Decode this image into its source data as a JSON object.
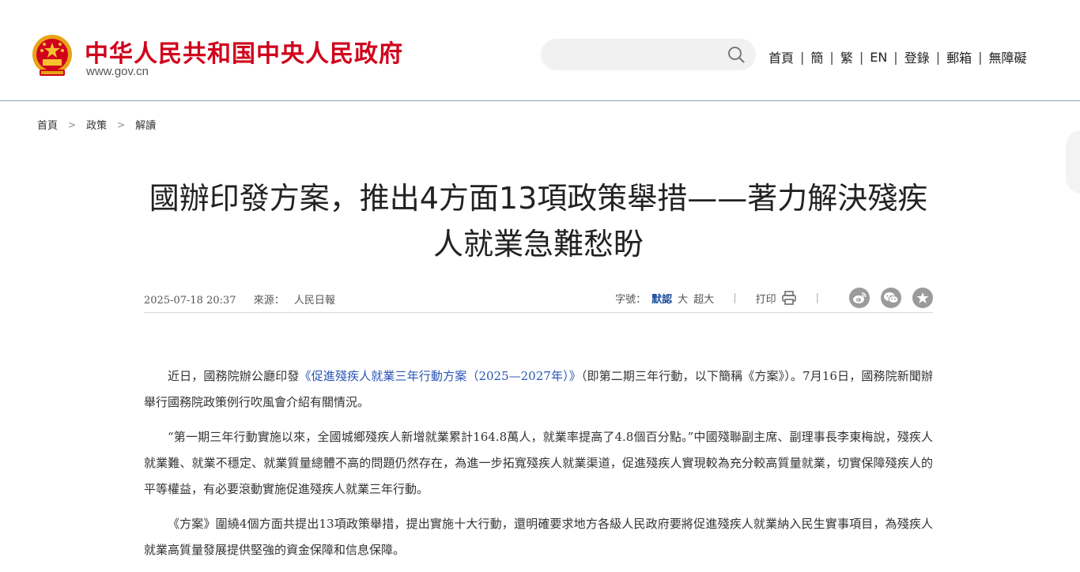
{
  "header": {
    "site_name": "中华人民共和国中央人民政府",
    "site_url": "www.gov.cn",
    "search_placeholder": "",
    "nav": [
      "首頁",
      "簡",
      "繁",
      "EN",
      "登錄",
      "郵箱",
      "無障礙"
    ],
    "nav_separator": "|"
  },
  "breadcrumb": {
    "items": [
      "首頁",
      "政策",
      "解讀"
    ],
    "separator": ">"
  },
  "article": {
    "title": "國辦印發方案，推出4方面13項政策舉措——著力解決殘疾人就業急難愁盼",
    "date": "2025-07-18 20:37",
    "source_label": "來源：",
    "source_value": "人民日報",
    "font_size_label": "字號：",
    "font_sizes": [
      "默認",
      "大",
      "超大"
    ],
    "font_size_selected": "默認",
    "print_label": "打印",
    "share_icons": [
      "weibo-icon",
      "wechat-icon",
      "favorite-star-icon"
    ],
    "paragraphs": [
      {
        "before": "近日，國務院辦公廳印發",
        "link": "《促進殘疾人就業三年行動方案（2025—2027年）》",
        "after": "（即第二期三年行動，以下簡稱《方案》）。7月16日，國務院新聞辦舉行國務院政策例行吹風會介紹有關情況。"
      },
      {
        "text": "“第一期三年行動實施以來，全國城鄉殘疾人新增就業累計164.8萬人，就業率提高了4.8個百分點。”中國殘聯副主席、副理事長李東梅說，殘疾人就業難、就業不穩定、就業質量總體不高的問題仍然存在，為進一步拓寬殘疾人就業渠道，促進殘疾人實現較為充分較高質量就業，切實保障殘疾人的平等權益，有必要滾動實施促進殘疾人就業三年行動。"
      },
      {
        "text": "《方案》圍繞4個方面共提出13項政策舉措，提出實施十大行動，還明確要求地方各級人民政府要將促進殘疾人就業納入民生實事項目，為殘疾人就業高質量發展提供堅強的資金保障和信息保障。"
      }
    ]
  },
  "colors": {
    "brand_red": "#d0021b",
    "link_blue": "#2a55b5",
    "active_blue": "#1a4c9c",
    "header_border": "#8aa3c4"
  }
}
